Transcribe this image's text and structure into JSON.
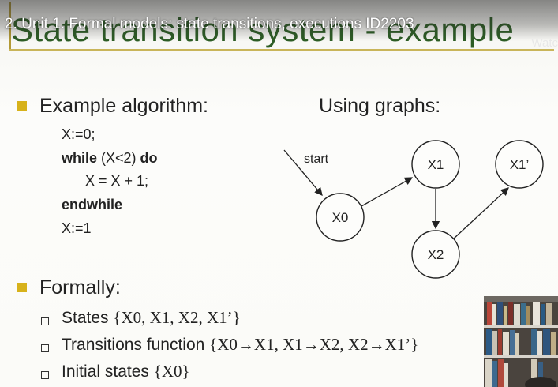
{
  "video": {
    "title": "2. Unit 1. Formal models: state transitions, executions ID2203",
    "watch_later_label": "Watc"
  },
  "slide": {
    "title": "State transition system - example",
    "example_heading": "Example algorithm:",
    "code": {
      "line1": "X:=0;",
      "while_kw": "while",
      "condition": " (X<2) ",
      "do_kw": "do",
      "body": "X = X + 1;",
      "endwhile_kw": "endwhile",
      "line5": "X:=1"
    },
    "graphs_heading": "Using graphs:",
    "graph": {
      "start_label": "start",
      "nodes": {
        "x0": "X0",
        "x1": "X1",
        "x2": "X2",
        "x1p": "X1’"
      }
    },
    "formally_heading": "Formally:",
    "items": [
      {
        "label": "States ",
        "value": "{X0, X1, X2, X1’}"
      },
      {
        "label": "Transitions function ",
        "value": "{X0→X1, X1→X2, X2→X1’}"
      },
      {
        "label": "Initial states ",
        "value": "{X0}"
      }
    ]
  },
  "colors": {
    "title_green": "#2d5d25",
    "bullet_gold": "#d7b21b"
  }
}
